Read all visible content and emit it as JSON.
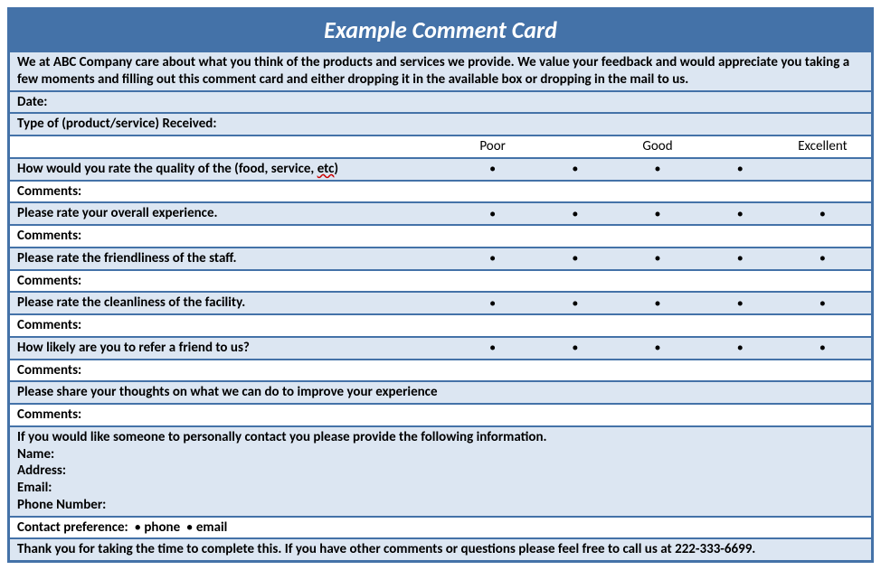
{
  "title": "Example Comment Card",
  "intro": "We at ABC Company care about what you think of the products and services we provide.  We value your feedback and would appreciate you taking a few moments and filling out this comment card and either dropping it in the available box or dropping in the mail to us.",
  "date_label": "Date:",
  "type_label": "Type of (product/service) Received:",
  "scale": {
    "poor": "Poor",
    "good": "Good",
    "excellent": "Excellent"
  },
  "q1": {
    "prefix": "How would you rate the quality of the (food, service, ",
    "etc": "etc",
    "suffix": ")"
  },
  "q2": "Please rate your overall experience.",
  "q3": "Please rate the friendliness of the staff.",
  "q4": "Please rate the cleanliness of the facility.",
  "q5": "How likely are you to refer a friend to us?",
  "comments_label": "Comments:",
  "improve_prompt": "Please share your thoughts on what we can do to improve your experience",
  "contact_prompt": "If you would like someone to personally contact you please provide the following information.",
  "contact": {
    "name": "Name:",
    "address": "Address:",
    "email": "Email:",
    "phone": "Phone Number:"
  },
  "preference": {
    "label": "Contact preference:",
    "opt1": "phone",
    "opt2": "email"
  },
  "thankyou": "Thank you for taking the time to complete this.  If you have other comments or questions please feel free to call us at 222-333-6699.",
  "dot": "•"
}
